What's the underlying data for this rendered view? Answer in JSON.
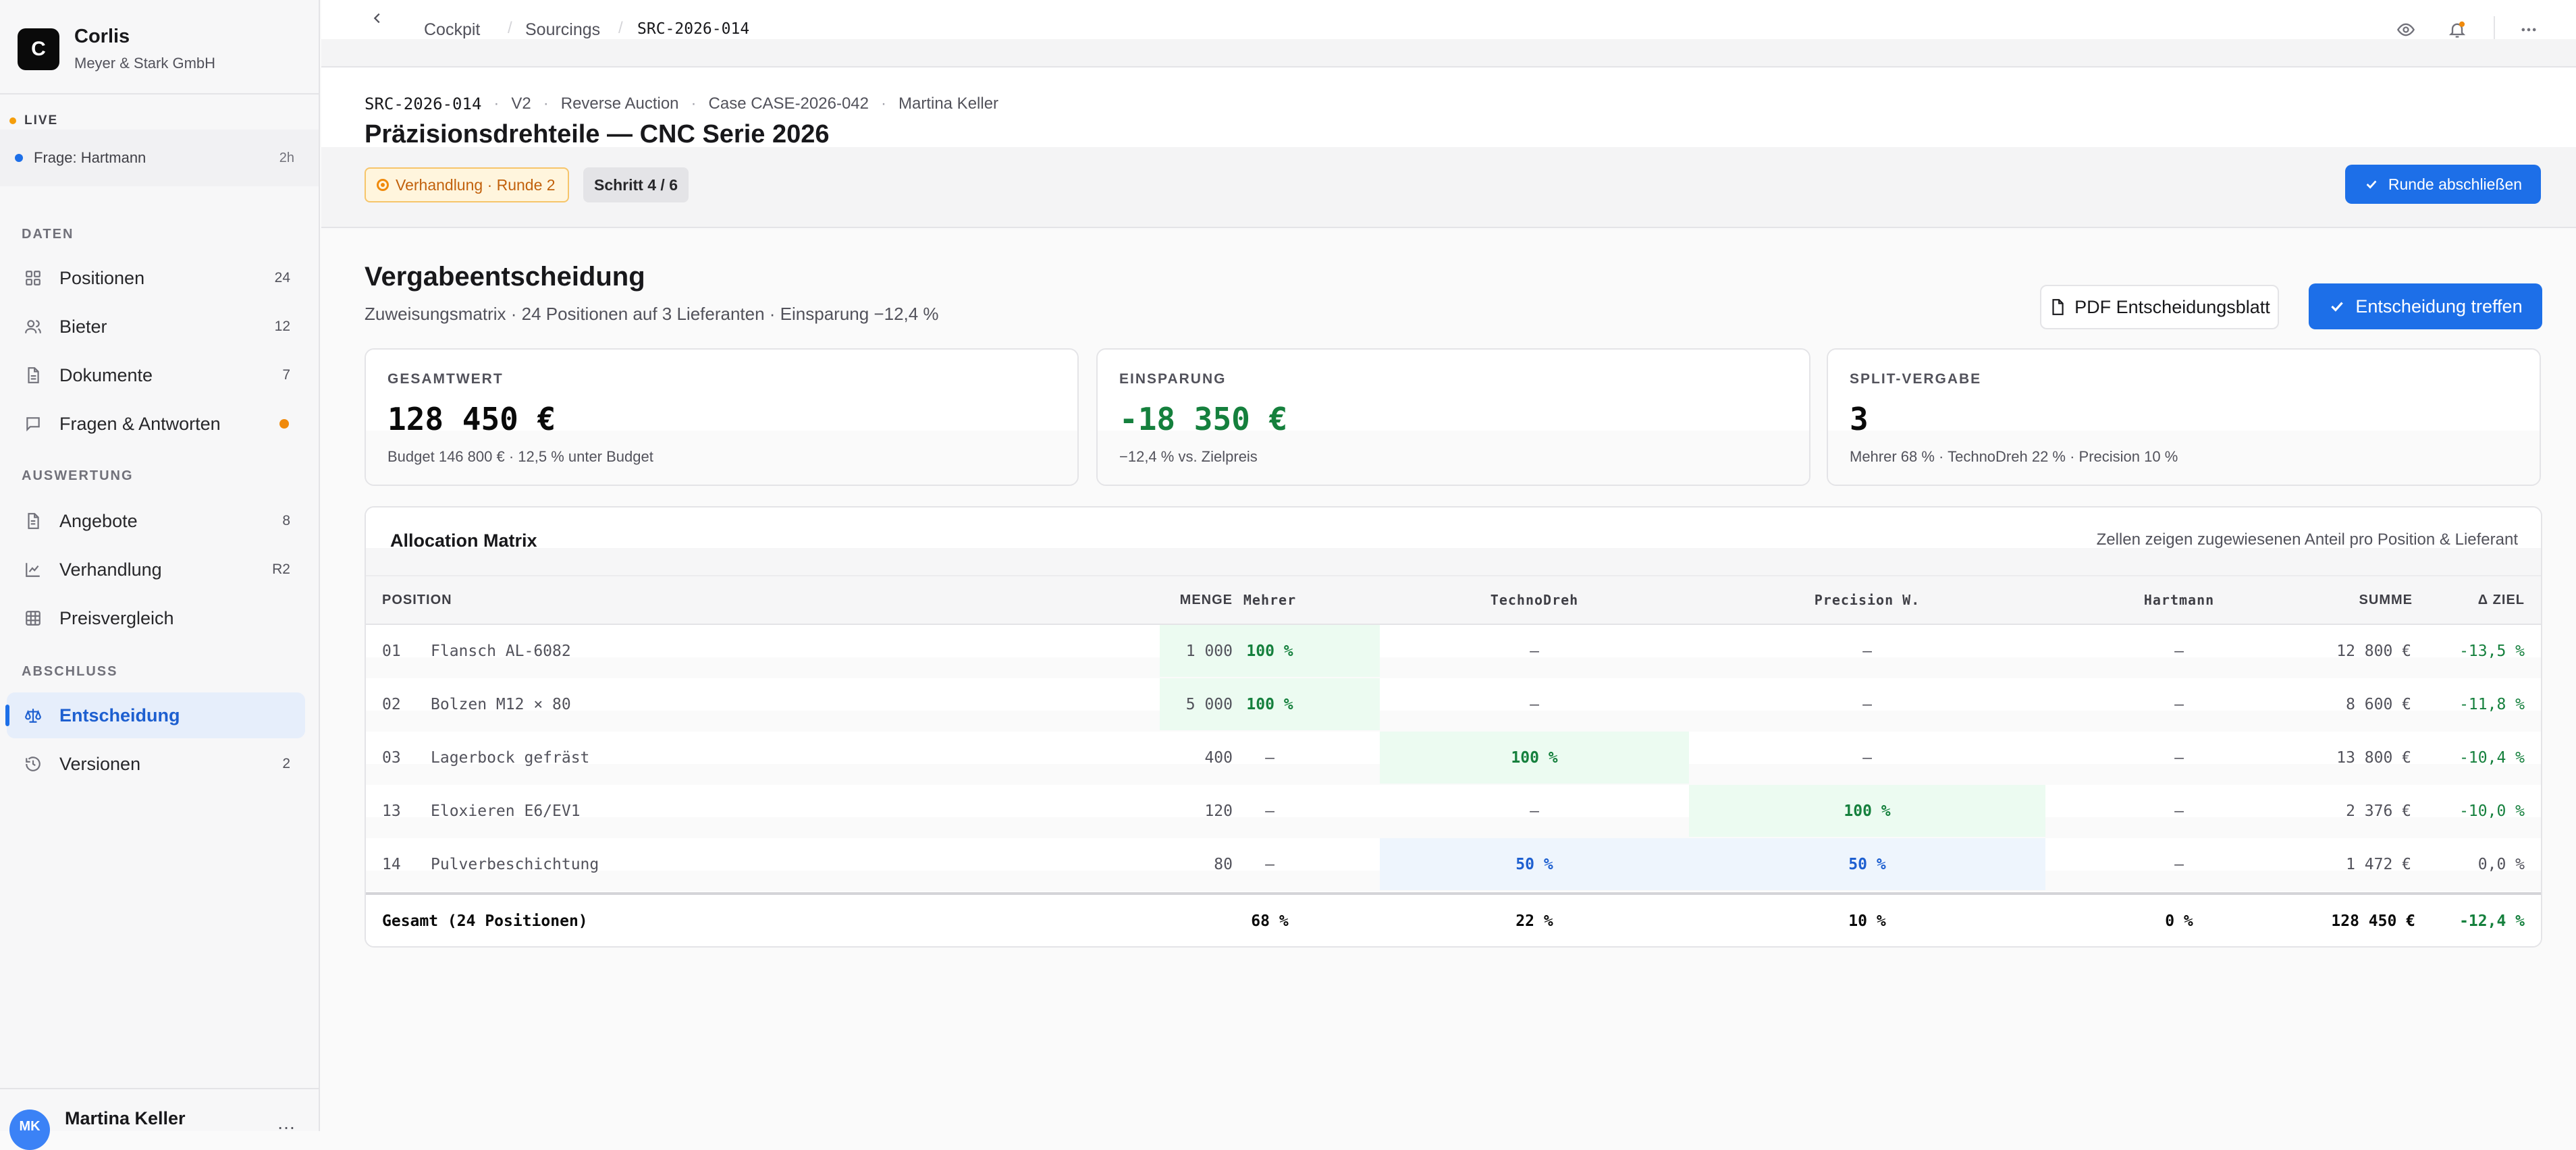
{
  "workspace": {
    "logo_letter": "C",
    "name": "Corlis",
    "company": "Meyer & Stark GmbH"
  },
  "live": {
    "label": "LIVE",
    "item_label": "Frage: Hartmann",
    "item_time": "2h"
  },
  "sidebar": {
    "sections": [
      "DATEN",
      "AUSWERTUNG",
      "ABSCHLUSS"
    ],
    "items": [
      {
        "label": "Positionen",
        "count": "24",
        "icon": "grid-icon"
      },
      {
        "label": "Bieter",
        "count": "12",
        "icon": "users-icon"
      },
      {
        "label": "Dokumente",
        "count": "7",
        "icon": "document-icon"
      },
      {
        "label": "Fragen & Antworten",
        "count": "",
        "icon": "chat-icon",
        "dot_color": "#f08a0c"
      },
      {
        "label": "Angebote",
        "count": "8",
        "icon": "file-icon"
      },
      {
        "label": "Verhandlung",
        "count": "R2",
        "icon": "chart-line-icon"
      },
      {
        "label": "Preisvergleich",
        "count": "",
        "icon": "table-icon"
      },
      {
        "label": "Entscheidung",
        "count": "",
        "icon": "scale-icon",
        "active": true
      },
      {
        "label": "Versionen",
        "count": "2",
        "icon": "history-icon"
      }
    ]
  },
  "user": {
    "initials": "MK",
    "name": "Martina Keller",
    "more": "…"
  },
  "topbar": {
    "breadcrumb": [
      "Cockpit",
      "Sourcings",
      "SRC-2026-014"
    ]
  },
  "header": {
    "code": "SRC-2026-014",
    "version": "V2",
    "type": "Reverse Auction",
    "case": "Case CASE-2026-042",
    "owner": "Martina Keller",
    "title": "Präzisionsdrehteile — CNC Serie 2026",
    "status_badge": "Verhandlung · Runde 2",
    "step_badge": "Schritt 4 / 6",
    "round_button": "Runde abschließen"
  },
  "decision": {
    "title": "Vergabeentscheidung",
    "subtitle": "Zuweisungsmatrix · 24 Positionen auf 3 Lieferanten · Einsparung −12,4 %",
    "pdf_button": "PDF Entscheidungsblatt",
    "decide_button": "Entscheidung treffen"
  },
  "kpis": [
    {
      "label": "GESAMTWERT",
      "value": "128 450 €",
      "note": "Budget 146 800 € · 12,5 % unter Budget"
    },
    {
      "label": "EINSPARUNG",
      "value": "-18 350 €",
      "note": "−12,4 % vs. Zielpreis",
      "color": "#15803d"
    },
    {
      "label": "SPLIT-VERGABE",
      "value": "3",
      "note": "Mehrer 68 % · TechnoDreh 22 % · Precision 10 %"
    }
  ],
  "matrix": {
    "title": "Allocation Matrix",
    "hint": "Zellen zeigen zugewiesenen Anteil pro Position & Lieferant",
    "columns": [
      "POSITION",
      "MENGE",
      "Mehrer",
      "TechnoDreh",
      "Precision W.",
      "Hartmann",
      "SUMME",
      "Δ ZIEL"
    ],
    "rows": [
      {
        "no": "01",
        "name": "Flansch AL-6082",
        "qty": "1 000",
        "alloc": [
          "100 %",
          "—",
          "—",
          "—"
        ],
        "sum": "12 800 €",
        "delta": "-13,5 %"
      },
      {
        "no": "02",
        "name": "Bolzen M12 × 80",
        "qty": "5 000",
        "alloc": [
          "100 %",
          "—",
          "—",
          "—"
        ],
        "sum": "8 600 €",
        "delta": "-11,8 %"
      },
      {
        "no": "03",
        "name": "Lagerbock gefräst",
        "qty": "400",
        "alloc": [
          "—",
          "100 %",
          "—",
          "—"
        ],
        "sum": "13 800 €",
        "delta": "-10,4 %"
      },
      {
        "no": "13",
        "name": "Eloxieren E6/EV1",
        "qty": "120",
        "alloc": [
          "—",
          "—",
          "100 %",
          "—"
        ],
        "sum": "2 376 €",
        "delta": "-10,0 %"
      },
      {
        "no": "14",
        "name": "Pulverbeschichtung",
        "qty": "80",
        "alloc": [
          "—",
          "50 %",
          "50 %",
          "—"
        ],
        "sum": "1 472 €",
        "delta": "0,0 %"
      }
    ],
    "total": {
      "label": "Gesamt (24 Positionen)",
      "alloc": [
        "68 %",
        "22 %",
        "10 %",
        "0 %"
      ],
      "sum": "128 450 €",
      "delta": "-12,4 %"
    }
  }
}
